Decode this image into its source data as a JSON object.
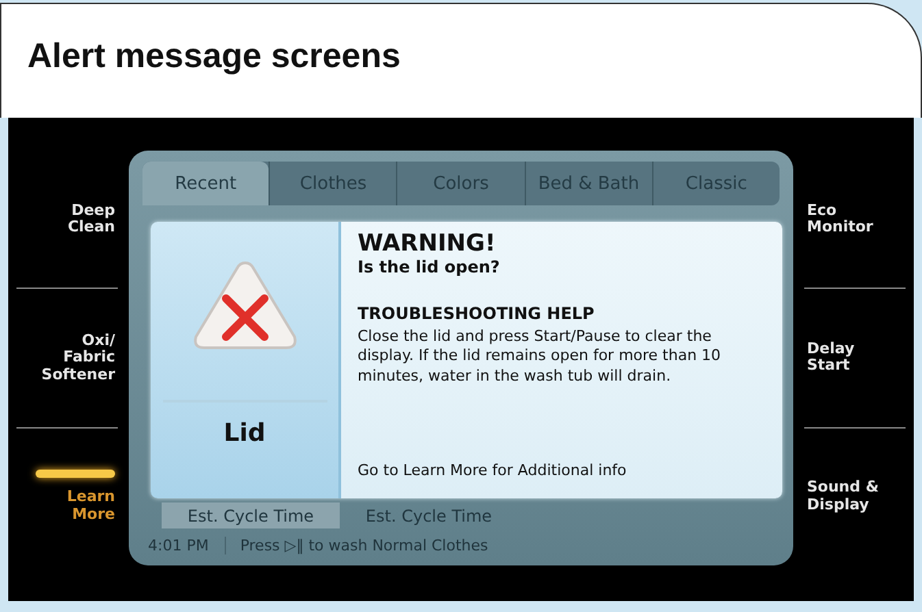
{
  "title": "Alert message screens",
  "left_menu": [
    {
      "label": "Deep Clean",
      "selected": false
    },
    {
      "label": "Oxi/ Fabric Softener",
      "selected": false
    },
    {
      "label": "Learn More",
      "selected": true
    }
  ],
  "right_menu": [
    {
      "label": "Eco Monitor",
      "selected": false
    },
    {
      "label": "Delay Start",
      "selected": false
    },
    {
      "label": "Sound & Display",
      "selected": false
    }
  ],
  "tabs": [
    {
      "label": "Recent",
      "selected": true
    },
    {
      "label": "Clothes",
      "selected": false
    },
    {
      "label": "Colors",
      "selected": false
    },
    {
      "label": "Bed & Bath",
      "selected": false
    },
    {
      "label": "Classic",
      "selected": false
    }
  ],
  "cycle_row": [
    {
      "label": "Est. Cycle Time",
      "selected": true
    },
    {
      "label": "Est. Cycle Time",
      "selected": false
    }
  ],
  "status_bar": {
    "time": "4:01 PM",
    "hint": "Press ▷‖ to wash Normal Clothes"
  },
  "alert": {
    "label": "Lid",
    "heading": "WARNING!",
    "question": "Is the lid open?",
    "help_title": "TROUBLESHOOTING HELP",
    "help_text": "Close the lid and press Start/Pause to clear the display. If the lid remains open for more than 10 minutes, water in the wash tub will drain.",
    "footer": "Go to Learn More for Additional info"
  }
}
